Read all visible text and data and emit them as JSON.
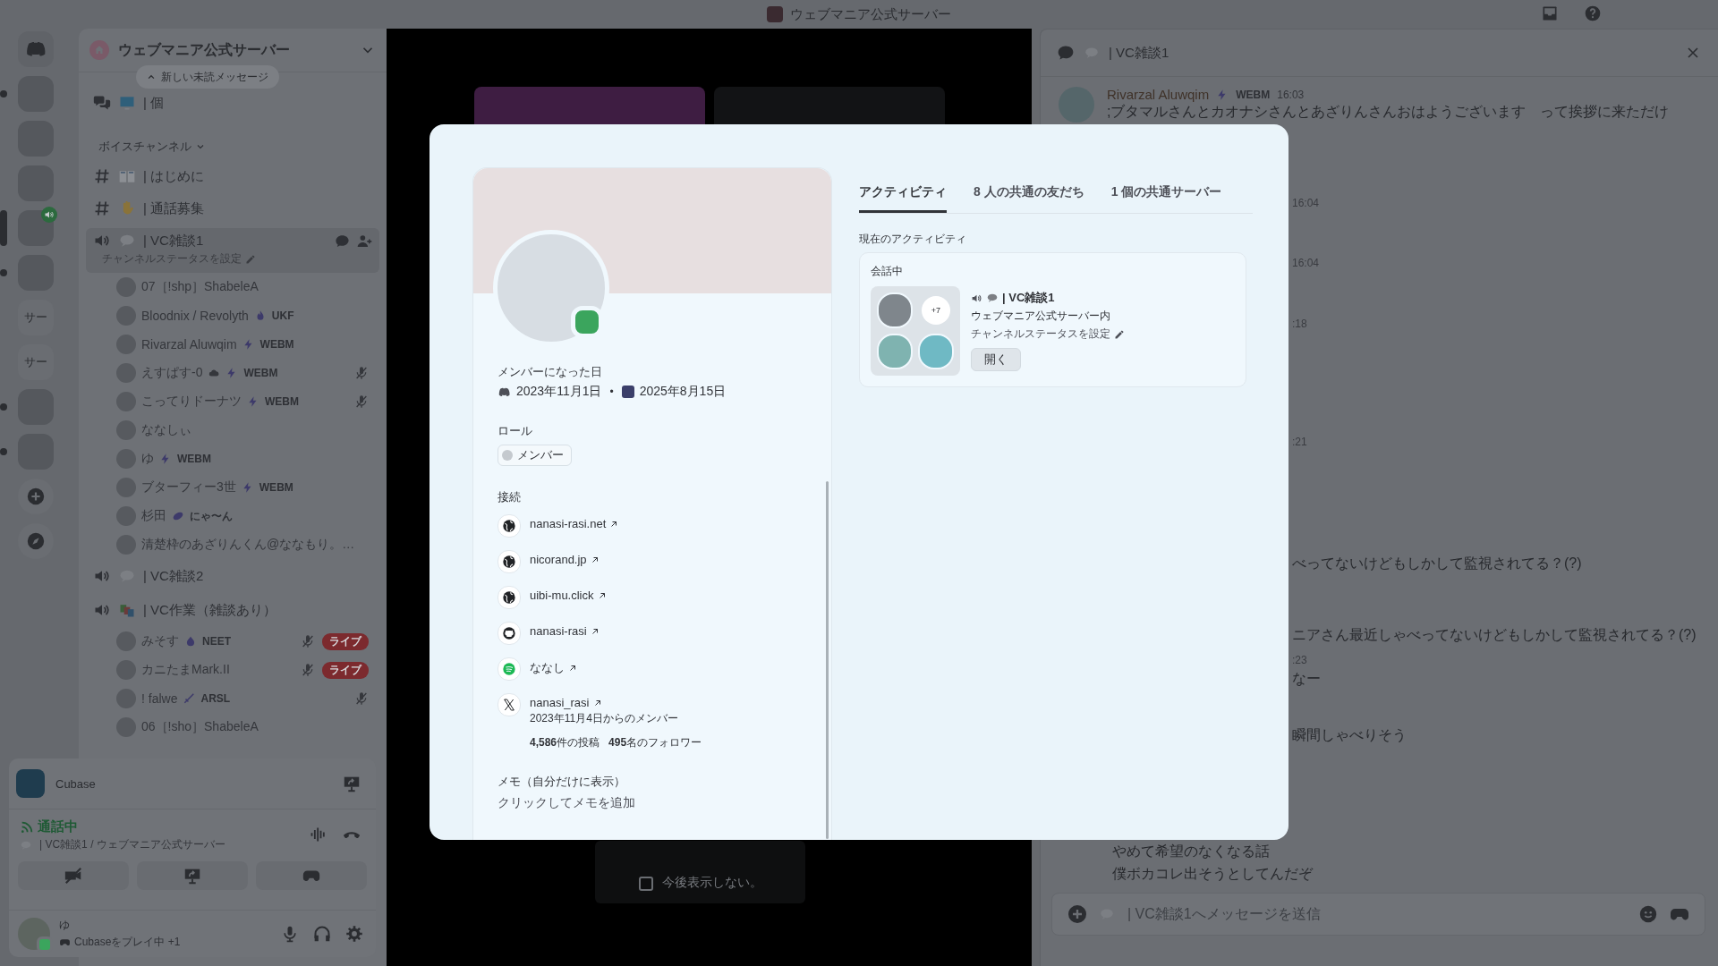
{
  "title_bar": {
    "title": "ウェブマニア公式サーバー"
  },
  "servers": [
    {
      "kind": "logo",
      "selected": false,
      "unread": false,
      "in_voice": false
    },
    {
      "kind": "image",
      "selected": false,
      "unread": true,
      "in_voice": false
    },
    {
      "kind": "image",
      "selected": false,
      "unread": false,
      "in_voice": false
    },
    {
      "kind": "image",
      "selected": false,
      "unread": false,
      "in_voice": false
    },
    {
      "kind": "image",
      "selected": true,
      "unread": false,
      "in_voice": true
    },
    {
      "kind": "image",
      "selected": false,
      "unread": true,
      "in_voice": false
    },
    {
      "kind": "label",
      "text": "サー",
      "selected": false,
      "unread": false,
      "in_voice": false
    },
    {
      "kind": "label",
      "text": "サー",
      "selected": false,
      "unread": false,
      "in_voice": false
    },
    {
      "kind": "image",
      "selected": false,
      "unread": true,
      "in_voice": false
    },
    {
      "kind": "image",
      "selected": false,
      "unread": true,
      "in_voice": false
    },
    {
      "kind": "add",
      "selected": false,
      "unread": false,
      "in_voice": false
    },
    {
      "kind": "discover",
      "selected": false,
      "unread": false,
      "in_voice": false
    }
  ],
  "sidebar": {
    "server_name": "ウェブマニア公式サーバー",
    "toast": "新しい未読メッセージ",
    "channels": [
      {
        "kind": "forum",
        "emoji": {
          "kind": "monitor"
        },
        "name": "| 個",
        "selected": false
      },
      {
        "kind": "category",
        "name": "ボイスチャンネル"
      },
      {
        "kind": "text",
        "emoji": {
          "kind": "book"
        },
        "name": "| はじめに",
        "selected": false
      },
      {
        "kind": "text",
        "emoji": {
          "kind": "hand"
        },
        "name": "| 通話募集",
        "selected": false
      },
      {
        "kind": "voice",
        "emoji": {
          "kind": "bubble"
        },
        "name": "| VC雑談1",
        "selected": true,
        "status": "チャンネルステータスを設定",
        "members": [
          {
            "name": "07［!shp］ShabeleA",
            "muted": false
          },
          {
            "name": "Bloodnix / Revolyth",
            "tag": {
              "kind": "flame",
              "text": "UKF"
            },
            "muted": false
          },
          {
            "name": "Rivarzal Aluwqim",
            "tag": {
              "kind": "bolt",
              "text": "WEBM"
            },
            "muted": false
          },
          {
            "name": "えすぱす-0",
            "status_icon": {
              "kind": "cloud"
            },
            "tag": {
              "kind": "bolt",
              "text": "WEBM"
            },
            "muted": true
          },
          {
            "name": "こってりドーナツ",
            "tag": {
              "kind": "bolt",
              "text": "WEBM"
            },
            "muted": true
          },
          {
            "name": "ななしぃ",
            "muted": false
          },
          {
            "name": "ゆ",
            "tag": {
              "kind": "bolt",
              "text": "WEBM"
            },
            "muted": false
          },
          {
            "name": "ブターフィー3世",
            "tag": {
              "kind": "bolt",
              "text": "WEBM"
            },
            "muted": false
          },
          {
            "name": "杉田",
            "tag": {
              "kind": "leaf",
              "text": "にゃ〜ん"
            },
            "muted": false
          },
          {
            "name": "清楚枠のあざりんくん@ななもり。…",
            "muted": false
          }
        ]
      },
      {
        "kind": "voice",
        "emoji": {
          "kind": "bubble"
        },
        "name": "| VC雑談2",
        "selected": false
      },
      {
        "kind": "voice",
        "emoji": {
          "kind": "blocks"
        },
        "name": "| VC作業（雑談あり）",
        "selected": false,
        "members": [
          {
            "name": "みそす",
            "tag": {
              "kind": "drop",
              "text": "NEET"
            },
            "muted": true,
            "badge": "ライブ"
          },
          {
            "name": "カニたまMark.II",
            "muted": true,
            "badge": "ライブ"
          },
          {
            "name": "! falwe",
            "tag": {
              "kind": "sword",
              "text": "ARSL"
            },
            "muted": true
          },
          {
            "name": "06［!sho］ShabeleA",
            "muted": false
          }
        ]
      }
    ]
  },
  "voice_panel": {
    "app": "Cubase",
    "state": "通話中",
    "channel": "| VC雑談1 / ウェブマニア公式サーバー",
    "user": {
      "name": "ゆ",
      "activity": "Cubaseをプレイ中",
      "extra": "+1",
      "online": true
    }
  },
  "stage": {
    "dont_show": {
      "label": "今後表示しない。",
      "checked": false
    }
  },
  "chat": {
    "channel": "| VC雑談1",
    "messages": [
      {
        "kind": "message",
        "author": "Rivarzal Aluwqim",
        "tag": {
          "kind": "bolt",
          "text": "WEBM"
        },
        "time": "16:03",
        "text": ";ブタマルさんとカオナシさんとあざりんさんおはようございます　って挨拶に来ただけ"
      },
      {
        "kind": "time_fragment",
        "text": "16:04"
      },
      {
        "kind": "time_fragment",
        "text": "16:04"
      },
      {
        "kind": "time_fragment",
        "text": ":18"
      },
      {
        "kind": "time_fragment",
        "text": ":21"
      },
      {
        "kind": "text_fragment",
        "text": "べってないけどもしかして監視されてる？(?)"
      },
      {
        "kind": "text_fragment",
        "text": "ニアさん最近しゃべってないけどもしかして監視されてる？(?)"
      },
      {
        "kind": "time_fragment",
        "text": ":23"
      },
      {
        "kind": "text_fragment",
        "text": "なー"
      },
      {
        "kind": "text_fragment",
        "text": "瞬間しゃべりそう"
      },
      {
        "kind": "line",
        "text": "やめて希望のなくなる話"
      },
      {
        "kind": "line",
        "text": "僕ボカコレ出そうとしてんだぞ"
      }
    ],
    "input": {
      "placeholder": "| VC雑談1へメッセージを送信"
    }
  },
  "modal": {
    "profile": {
      "online": true,
      "member_since_label": "メンバーになった日",
      "dates": [
        "2023年11月1日",
        "2025年8月15日"
      ],
      "date_separator": "•",
      "roles_label": "ロール",
      "roles": [
        {
          "name": "メンバー",
          "color": "#c4c9ce"
        }
      ],
      "connections_label": "接続",
      "connections": [
        {
          "kind": "website",
          "label": "nanasi-rasi.net"
        },
        {
          "kind": "website",
          "label": "nicorand.jp"
        },
        {
          "kind": "website",
          "label": "uibi-mu.click"
        },
        {
          "kind": "github",
          "label": "nanasi-rasi"
        },
        {
          "kind": "spotify",
          "label": "ななし"
        },
        {
          "kind": "x",
          "label": "nanasi_rasi",
          "since": "2023年11月4日からのメンバー",
          "stats": [
            "**4,586**件の投稿",
            "**495**名のフォロワー"
          ]
        }
      ],
      "note": {
        "label": "メモ（自分だけに表示）",
        "placeholder": "クリックしてメモを追加"
      }
    },
    "tabs": [
      {
        "label": "アクティビティ",
        "selected": true
      },
      {
        "label": "8 人の共通の友だち",
        "selected": false
      },
      {
        "label": "1 個の共通サーバー",
        "selected": false
      }
    ],
    "activity": {
      "heading": "現在のアクティビティ",
      "label": "会話中",
      "more": "+7",
      "channel": "| VC雑談1",
      "server": "ウェブマニア公式サーバー内",
      "status": "チャンネルステータスを設定",
      "button": "開く"
    }
  }
}
